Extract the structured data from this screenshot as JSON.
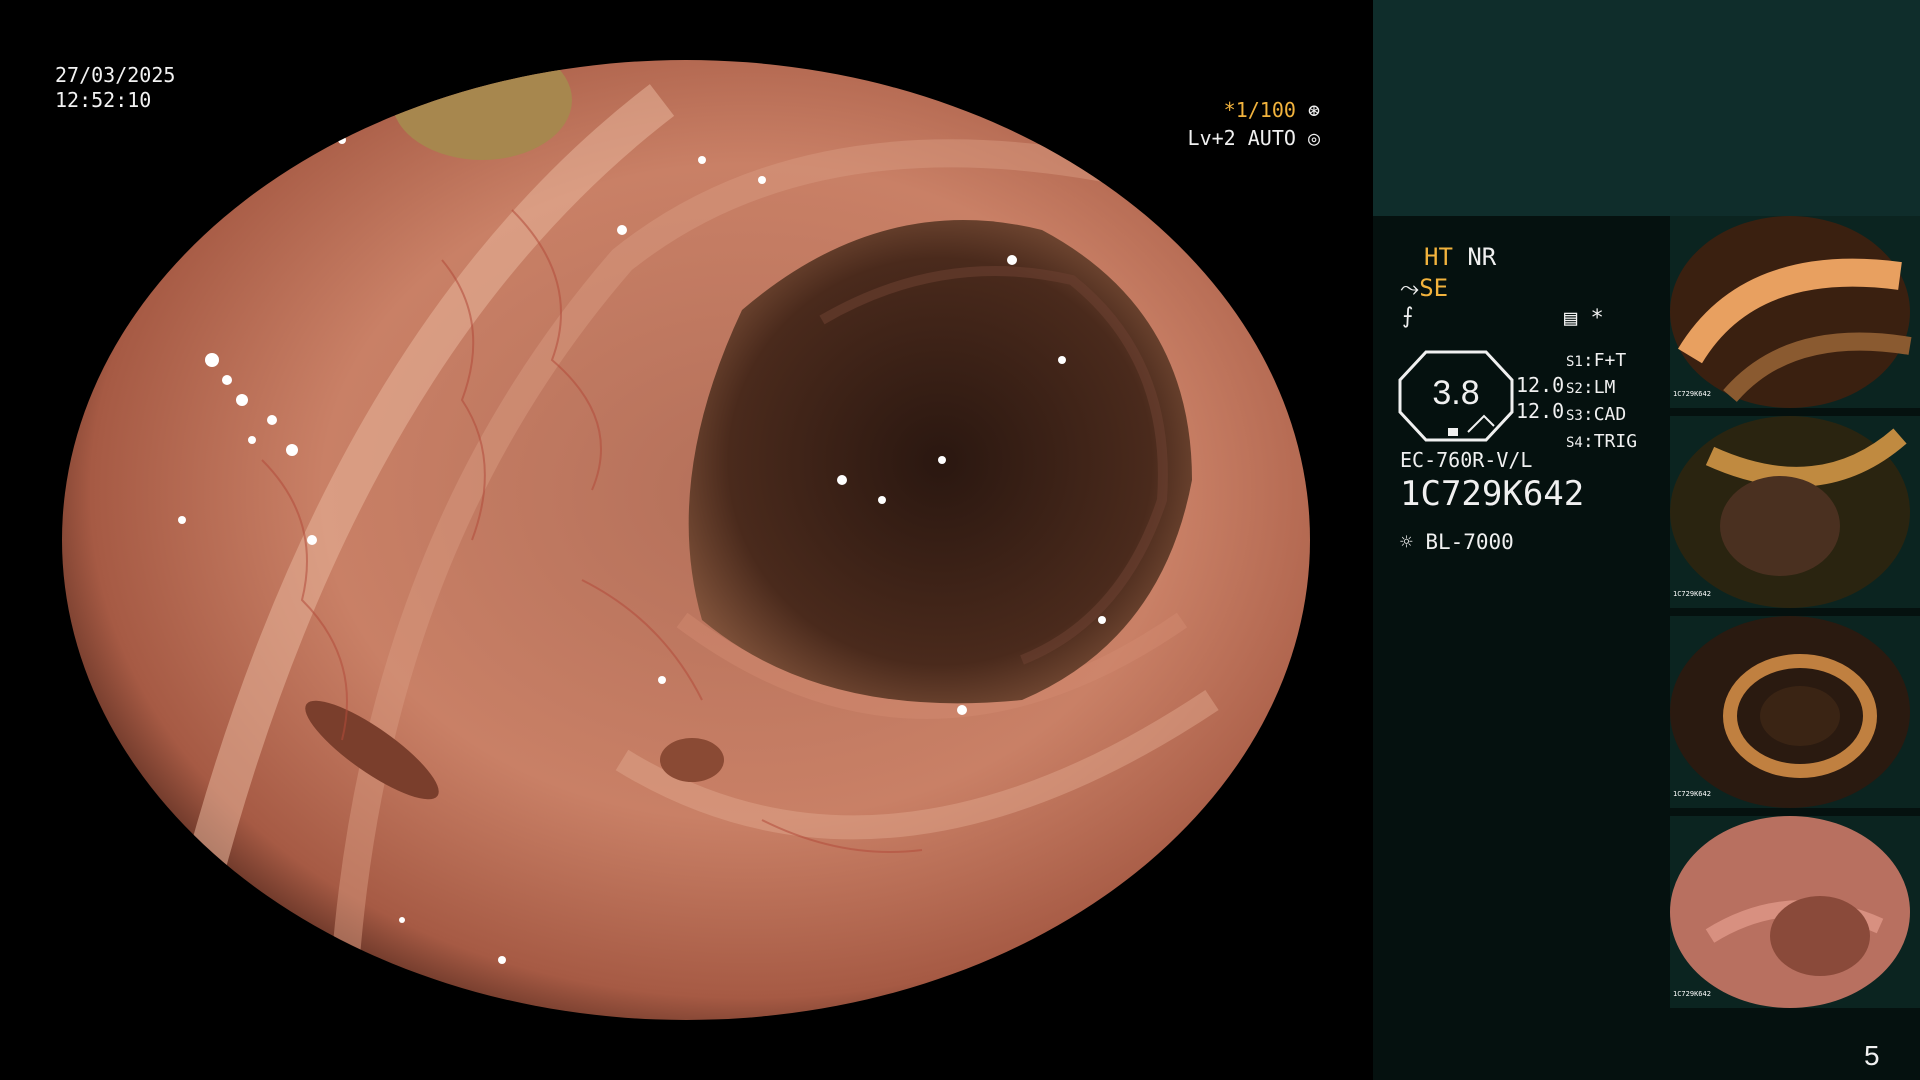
{
  "main_view": {
    "date": "27/03/2025",
    "time": "12:52:10",
    "shutter": "*1/100",
    "level": "Lv+2 AUTO"
  },
  "panel": {
    "mode_ht": "HT",
    "mode_nr": "NR",
    "mode_se": "SE",
    "asterisk": "*",
    "zoom": "3.8",
    "zoom_a": "12.0",
    "zoom_b": "12.0",
    "slots": [
      {
        "key": "S1",
        "value": "F+T"
      },
      {
        "key": "S2",
        "value": "LM"
      },
      {
        "key": "S3",
        "value": "CAD"
      },
      {
        "key": "S4",
        "value": "TRIG"
      }
    ],
    "scope_model": "EC-760R-V/L",
    "scope_serial": "1C729K642",
    "light_source": "BL-7000"
  },
  "thumbnails": [
    {
      "label": "1C729K642"
    },
    {
      "label": "1C729K642"
    },
    {
      "label": "1C729K642"
    },
    {
      "label": "1C729K642"
    }
  ],
  "page_number": "5",
  "colors": {
    "panel_bg": "#05110f",
    "panel_top_bg": "#0f2d2b",
    "accent_orange": "#f2b33d",
    "mucosa": "#c87a62",
    "lumen": "#2a1710"
  }
}
